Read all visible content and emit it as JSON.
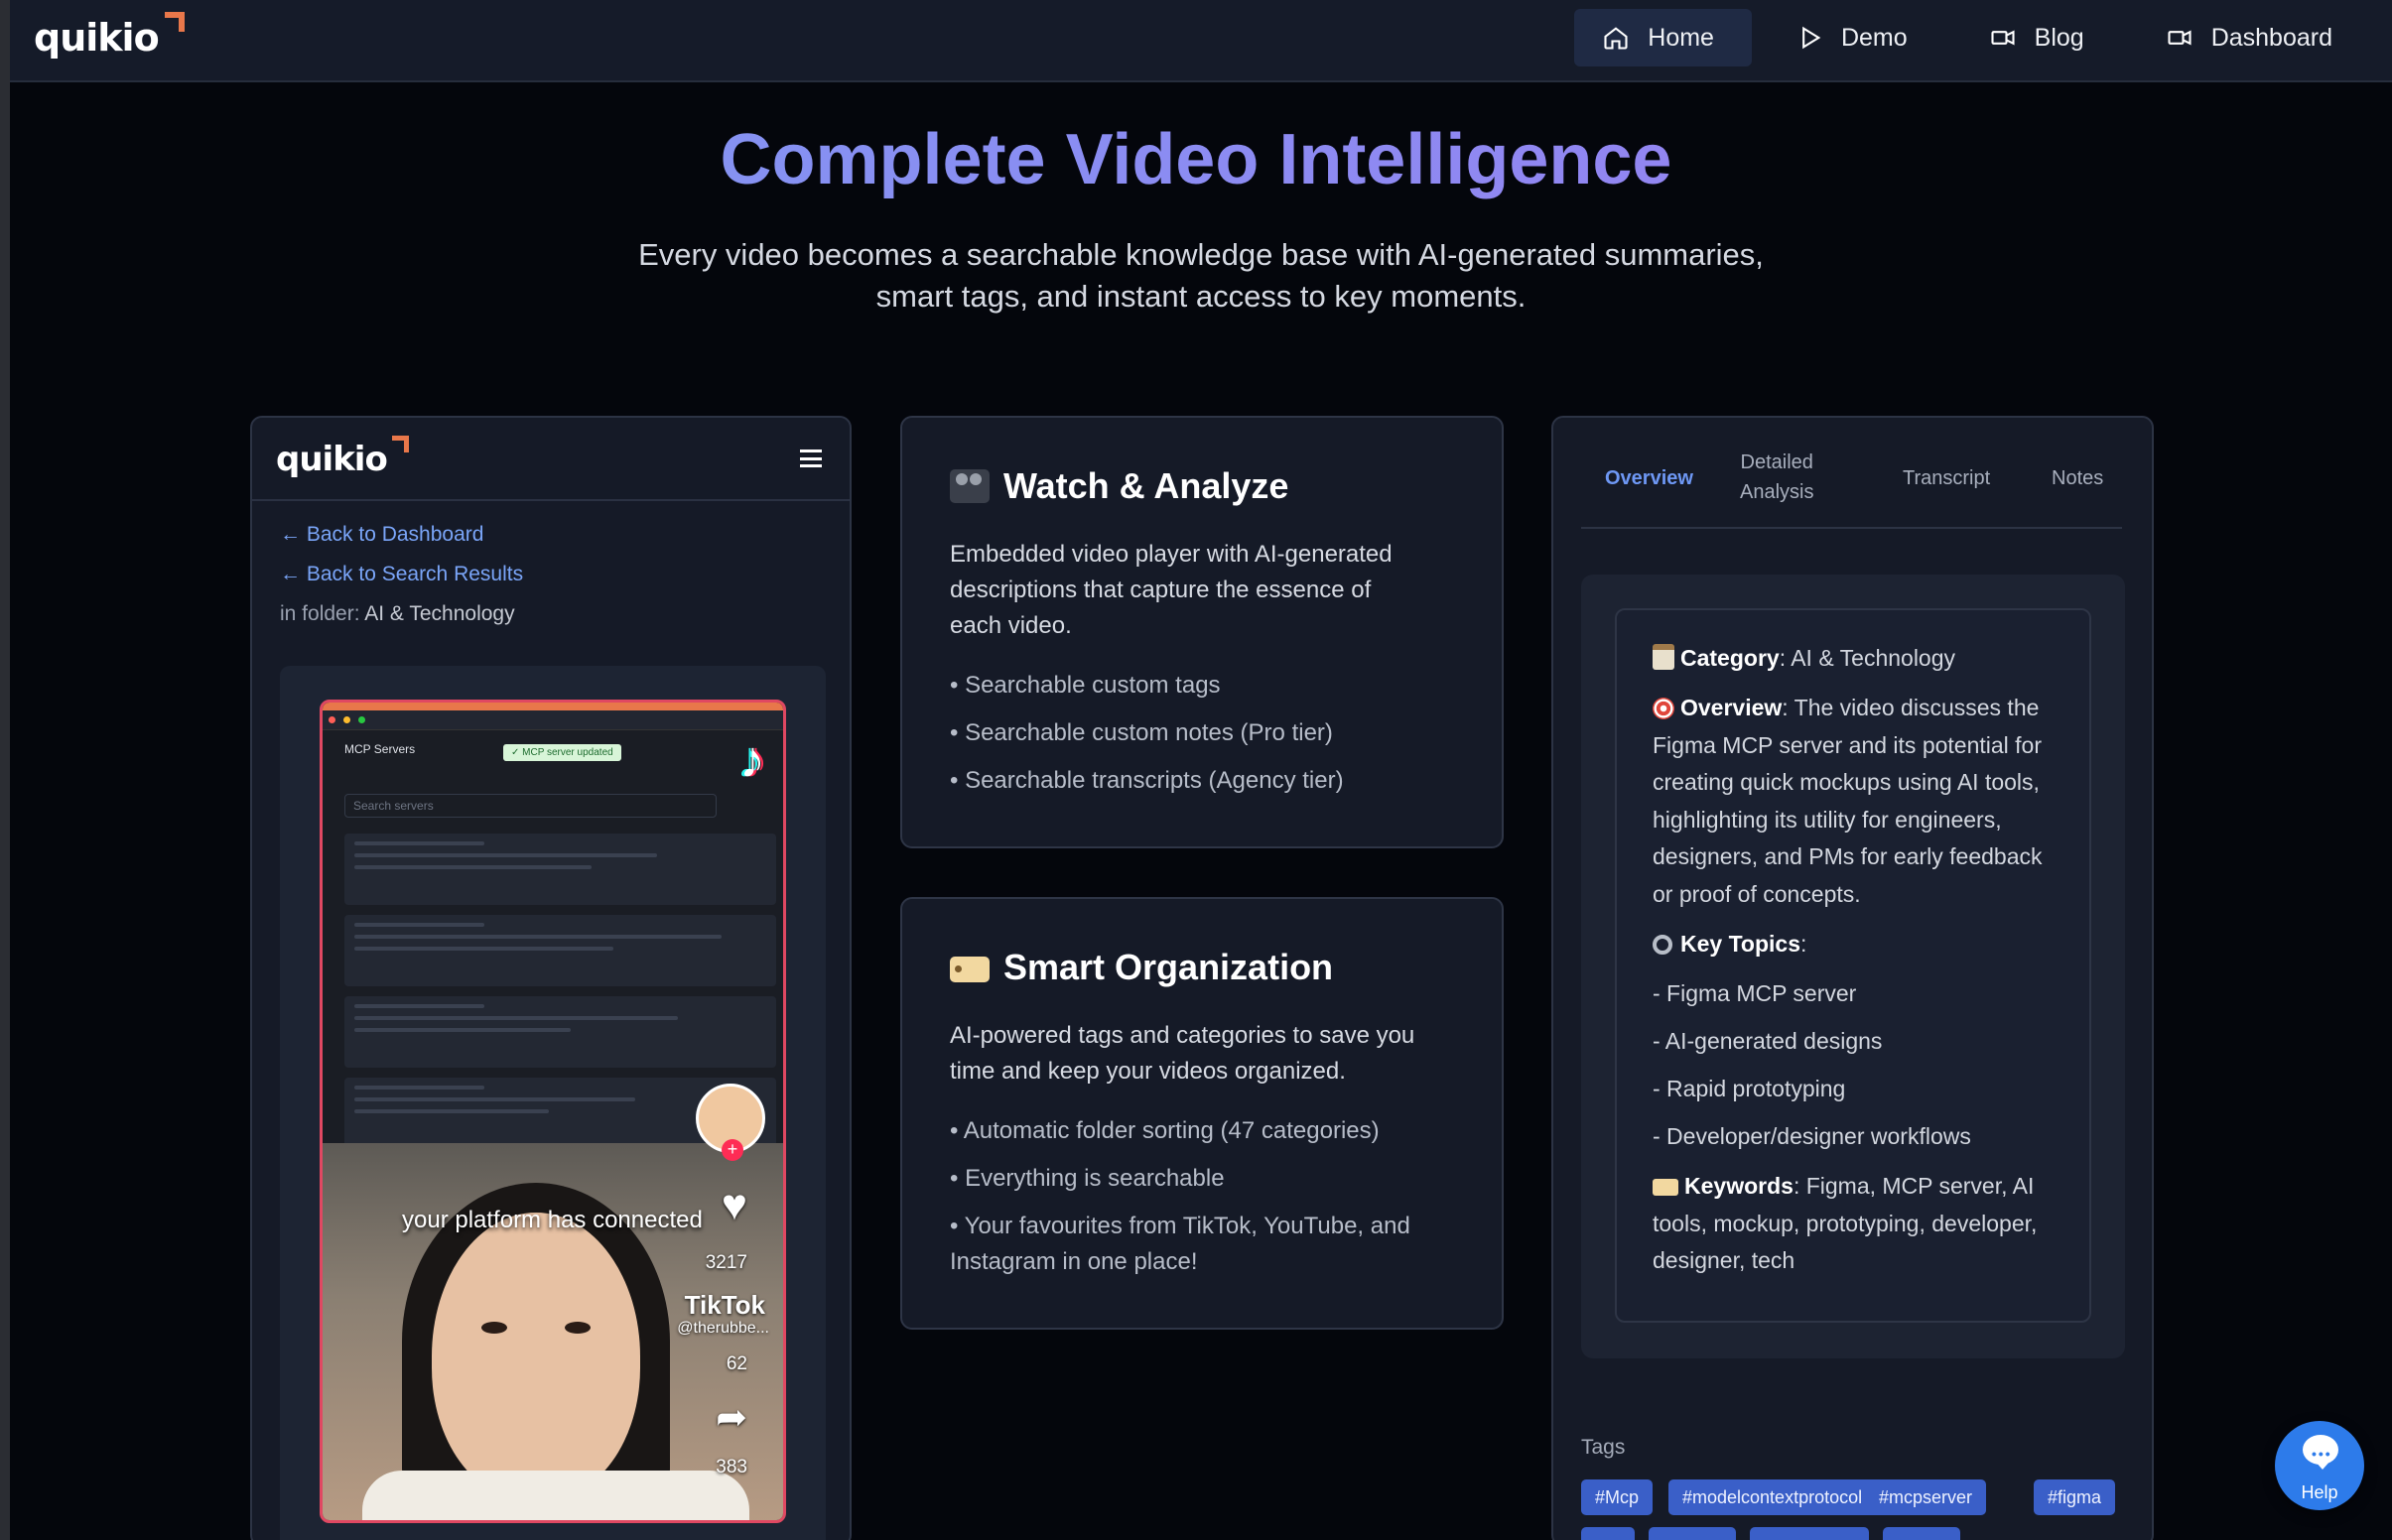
{
  "brand": "quikio",
  "nav": {
    "items": [
      {
        "label": "Home",
        "icon": "home-icon",
        "active": true
      },
      {
        "label": "Demo",
        "icon": "play-icon",
        "active": false
      },
      {
        "label": "Blog",
        "icon": "video-camera-icon",
        "active": false
      },
      {
        "label": "Dashboard",
        "icon": "video-camera-icon",
        "active": false
      }
    ]
  },
  "hero": {
    "title": "Complete Video Intelligence",
    "subtitle_line1": "Every video becomes a searchable knowledge base with AI-generated summaries,",
    "subtitle_line2": "smart tags, and instant access to key moments."
  },
  "preview": {
    "brand": "quikio",
    "back_dashboard": "← Back to Dashboard",
    "back_search": "← Back to Search Results",
    "folder_prefix": "in folder: ",
    "folder_name": "AI & Technology",
    "video": {
      "screen_title": "MCP Servers",
      "badge": "✓ MCP server updated",
      "search_placeholder": "Search servers",
      "caption": "your platform has connected",
      "likes": "3217",
      "comments": "62",
      "shares": "383",
      "platform": "TikTok",
      "handle": "@therubbe..."
    }
  },
  "cards": [
    {
      "icon": "movie-camera-icon",
      "title": "Watch & Analyze",
      "desc_l1": "Embedded video player with AI-generated",
      "desc_l2": "descriptions that capture the essence of",
      "desc_l3": "each video.",
      "items": [
        "• Searchable custom tags",
        "• Searchable custom notes (Pro tier)",
        "• Searchable transcripts (Agency tier)"
      ]
    },
    {
      "icon": "label-tag-icon",
      "title": "Smart Organization",
      "desc_l1": "AI-powered tags and categories to save you",
      "desc_l2": "time and keep your videos organized.",
      "items": [
        "• Automatic folder sorting (47 categories)",
        "• Everything is searchable",
        "• Your favourites from TikTok, YouTube, and",
        "Instagram in one place!"
      ]
    }
  ],
  "details": {
    "tabs": [
      "Overview",
      "Detailed",
      "Analysis",
      "Transcript",
      "Notes"
    ],
    "category_label": "Category",
    "category_value": "AI & Technology",
    "overview_label": "Overview",
    "overview_lines": [
      ": The video discusses the",
      "Figma MCP server and its potential for",
      "creating quick mockups using AI tools,",
      "highlighting its utility for engineers,",
      "designers, and PMs for early feedback",
      "or proof of concepts."
    ],
    "topics_label": "Key Topics",
    "topics": [
      "- Figma MCP server",
      "- AI-generated designs",
      "- Rapid prototyping",
      "- Developer/designer workflows"
    ],
    "keywords_label": "Keywords",
    "keywords_lines": [
      ": Figma, MCP server, AI",
      "tools, mockup, prototyping, developer,",
      "designer, tech"
    ],
    "tags_label": "Tags",
    "tags": [
      "#Mcp",
      "#modelcontextprotocol",
      "#mcpserver",
      "#figma"
    ]
  },
  "help": {
    "label": "Help"
  },
  "colors": {
    "accent": "#6e98f5",
    "tag": "#3a5fc8",
    "title_gradient_start": "#7c9bf2",
    "title_gradient_end": "#9b7cf1"
  }
}
